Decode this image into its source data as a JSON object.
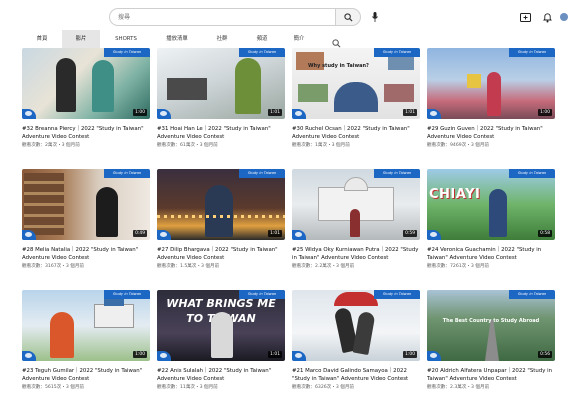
{
  "search": {
    "placeholder": "搜尋"
  },
  "tabs": [
    {
      "label": "首頁",
      "active": false
    },
    {
      "label": "影片",
      "active": true
    },
    {
      "label": "SHORTS",
      "active": false
    },
    {
      "label": "播放清單",
      "active": false
    },
    {
      "label": "社群",
      "active": false
    },
    {
      "label": "頻道",
      "active": false
    },
    {
      "label": "簡介",
      "active": false
    }
  ],
  "thumbnail_badge": "Study in Taiwan",
  "colors": {
    "accent": "#1c66c4",
    "badge_bg": "#0d0d0d"
  },
  "videos": [
    {
      "title": "#32 Breanna Piercy｜2022 \"Study in Taiwan\" Adventure Video Contest",
      "meta": "觀看次數：2萬次・3 個月前",
      "duration": "1:00",
      "overlay": ""
    },
    {
      "title": "#31 Hoai Han Le｜2022 \"Study in Taiwan\" Adventure Video Contest",
      "meta": "觀看次數：61萬次・3 個月前",
      "duration": "1:01",
      "overlay": ""
    },
    {
      "title": "#30 Ruchel Ocsan｜2022 \"Study in Taiwan\" Adventure Video Contest",
      "meta": "觀看次數：1萬次・3 個月前",
      "duration": "1:01",
      "overlay": "Why study in Taiwan?"
    },
    {
      "title": "#29 Guzin Guven｜2022 \"Study in Taiwan\" Adventure Video Contest",
      "meta": "觀看次數：9469次・3 個月前",
      "duration": "1:00",
      "overlay": ""
    },
    {
      "title": "#28 Melia Natalia｜2022 \"Study in Taiwan\" Adventure Video Contest",
      "meta": "觀看次數：3167次・3 個月前",
      "duration": "0:49",
      "overlay": ""
    },
    {
      "title": "#27 Dilip Bhargava｜2022 \"Study in Taiwan\" Adventure Video Contest",
      "meta": "觀看次數：1.5萬次・3 個月前",
      "duration": "1:01",
      "overlay": ""
    },
    {
      "title": "#25 Widya Oky Kurniawan Putra｜2022 \"Study in Taiwan\" Adventure Video Contest",
      "meta": "觀看次數：2.2萬次・3 個月前",
      "duration": "0:59",
      "overlay": ""
    },
    {
      "title": "#24 Veronica Guachamin｜2022 \"Study in Taiwan\" Adventure Video Contest",
      "meta": "觀看次數：7261次・3 個月前",
      "duration": "0:58",
      "overlay": "CHIAYI"
    },
    {
      "title": "#23 Teguh Gumilar｜2022 \"Study in Taiwan\" Adventure Video Contest",
      "meta": "觀看次數：5615次・3 個月前",
      "duration": "1:00",
      "overlay": ""
    },
    {
      "title": "#22 Anis Sulalah｜2022 \"Study in Taiwan\" Adventure Video Contest",
      "meta": "觀看次數：11萬次・3 個月前",
      "duration": "1:01",
      "overlay": "WHAT BRINGS ME TO TAIWAN"
    },
    {
      "title": "#21 Marco David Galindo Samayoa｜2022 \"Study in Taiwan\" Adventure Video Contest",
      "meta": "觀看次數：6326次・3 個月前",
      "duration": "1:00",
      "overlay": ""
    },
    {
      "title": "#20 Aldrich Alfatera Unpapar｜2022 \"Study in Taiwan\" Adventure Video Contest",
      "meta": "觀看次數：2.3萬次・3 個月前",
      "duration": "0:56",
      "overlay": "The Best Country to Study Abroad"
    }
  ]
}
